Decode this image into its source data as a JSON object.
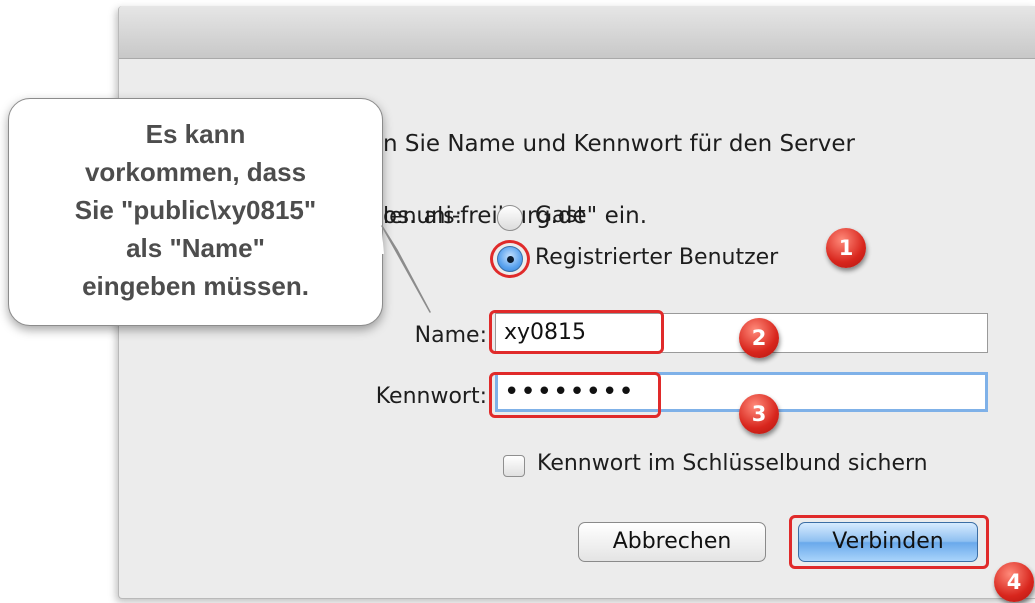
{
  "dialog": {
    "prompt_line1": "n Sie Name und Kennwort für den Server",
    "prompt_line2": "os.uni-freiburg.de\" ein.",
    "connect_as_label": "len als:",
    "radio_guest": "Gast",
    "radio_registered": "Registrierter Benutzer",
    "name_label": "Name:",
    "name_value": "xy0815",
    "password_label": "Kennwort:",
    "password_value": "••••••••",
    "keychain_label": "Kennwort im Schlüsselbund sichern",
    "cancel_button": "Abbrechen",
    "connect_button": "Verbinden"
  },
  "bubble": {
    "text": "Es kann\nvorkommen, dass\nSie \"public\\xy0815\"\nals \"Name\"\neingeben müssen."
  },
  "markers": [
    "1",
    "2",
    "3",
    "4"
  ],
  "colors": {
    "annotation_red": "#e02a2a",
    "focus_blue": "#7fb1e8",
    "default_button_blue": "#6aa9eb"
  }
}
